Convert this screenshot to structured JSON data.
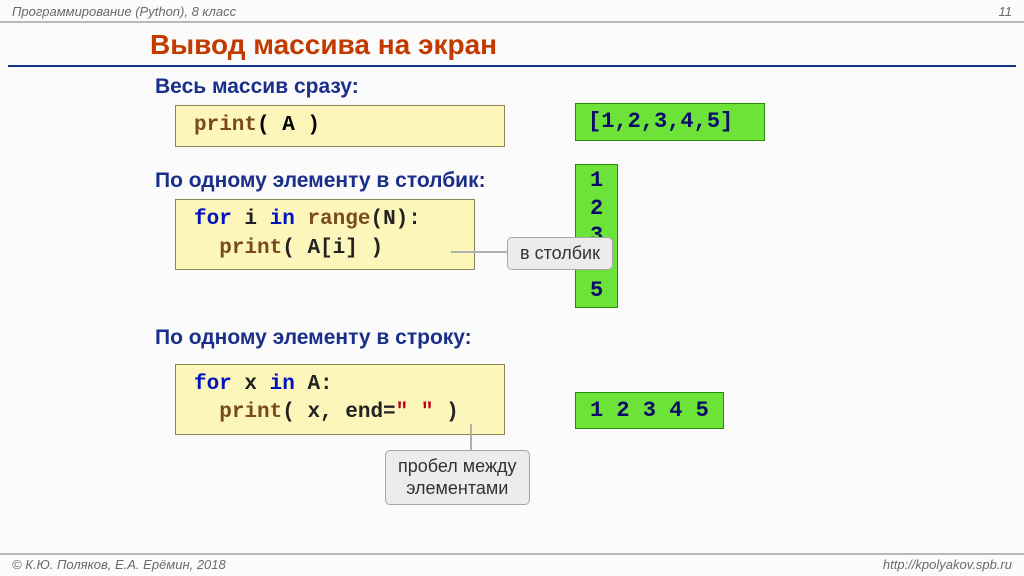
{
  "header": {
    "course": "Программирование (Python), 8 класс",
    "page": "11"
  },
  "title": "Вывод массива на экран",
  "sections": {
    "s1_label": "Весь массив сразу:",
    "s1_code_print": "print",
    "s1_code_rest": "( A )",
    "s1_out": "[1,2,3,4,5]",
    "s2_label": "По одному элементу в столбик:",
    "s2_code_for": "for",
    "s2_code_mid1": " i ",
    "s2_code_in": "in",
    "s2_code_mid2": " ",
    "s2_code_range": "range",
    "s2_code_tail": "(N):\n  ",
    "s2_code_print": "print",
    "s2_code_rest": "( A[i] )",
    "s2_callout": "в столбик",
    "s2_out": "1\n2\n3\n4\n5",
    "s3_label": "По одному элементу в строку:",
    "s3_code_for": "for",
    "s3_code_mid1": " x ",
    "s3_code_in": "in",
    "s3_code_mid2": " A:\n  ",
    "s3_code_print": "print",
    "s3_code_rest1": "( x, end=",
    "s3_code_str": "\" \"",
    "s3_code_rest2": " )",
    "s3_callout": "пробел между\nэлементами",
    "s3_out": "1 2 3 4 5"
  },
  "footer": {
    "copyright": "© К.Ю. Поляков, Е.А. Ерёмин, 2018",
    "url": "http://kpolyakov.spb.ru"
  }
}
